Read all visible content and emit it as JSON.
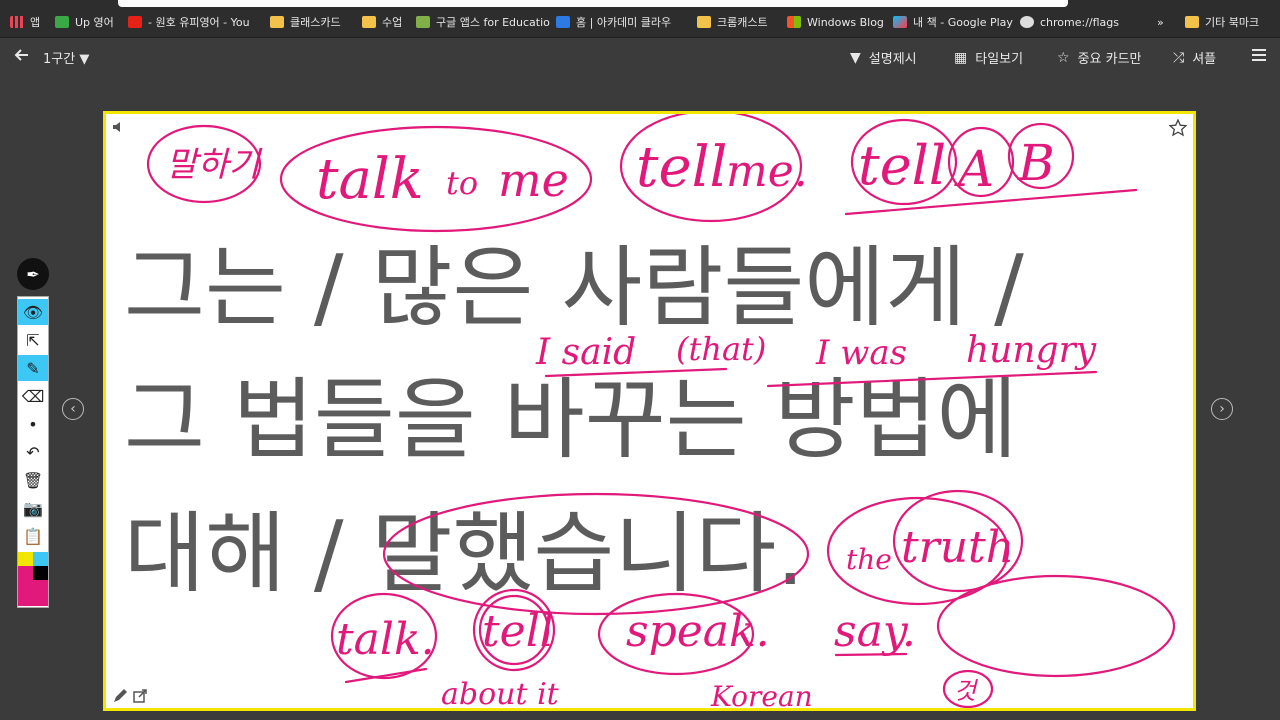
{
  "bookmarks": [
    {
      "label": "앱",
      "icon": "apps-grid-icon"
    },
    {
      "label": "Up 영어",
      "icon": "green-square-icon"
    },
    {
      "label": "- 원호 유피영어 - You",
      "icon": "youtube-icon"
    },
    {
      "label": "클래스카드",
      "icon": "folder-icon"
    },
    {
      "label": "수업",
      "icon": "folder-icon"
    },
    {
      "label": "구글 앱스 for Educatio",
      "icon": "image-icon"
    },
    {
      "label": "홈 | 아카데미 클라우",
      "icon": "ac-icon"
    },
    {
      "label": "크롬캐스트",
      "icon": "folder-icon"
    },
    {
      "label": "Windows Blog",
      "icon": "windows-icon"
    },
    {
      "label": "내 책 - Google Play",
      "icon": "play-icon"
    },
    {
      "label": "chrome://flags",
      "icon": "radiation-icon"
    },
    {
      "label": "»",
      "icon": ""
    },
    {
      "label": "기타 북마크",
      "icon": "folder-icon"
    }
  ],
  "header": {
    "section": "1구간 ▼",
    "explain": "설명제시",
    "tile": "타일보기",
    "important": "중요 카드만",
    "shuffle": "셔플"
  },
  "card": {
    "line1": "그는 / 많은 사람들에게 /",
    "line2": "그 법들을 바꾸는 방법에",
    "line3": "대해 / 말했습니다."
  },
  "annotations": {
    "malhae": "말하기",
    "talk_to_me": "talk",
    "to": "to",
    "me1": "me",
    "tell": "tell",
    "me2": "me.",
    "tell2": "tell",
    "a": "A",
    "b": "B",
    "i_said": "I said",
    "that": "(that)",
    "i_was": "I was",
    "hungry": "hungry",
    "the": "the",
    "truth": "truth",
    "talk": "talk.",
    "tell3": "tell",
    "about_it": "about it",
    "speak": "speak.",
    "korean": "Korean",
    "say": "say.",
    "geot": "것"
  },
  "colors": {
    "accent": "#e0197a",
    "card_border": "#f2e600",
    "text": "#5c5c5c"
  }
}
